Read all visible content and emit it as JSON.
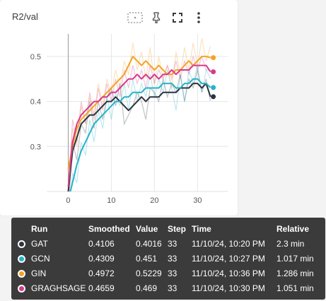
{
  "card": {
    "title": "R2/val",
    "tools": [
      {
        "name": "data-selection-icon"
      },
      {
        "name": "pin-icon"
      },
      {
        "name": "fullscreen-icon"
      },
      {
        "name": "more-vert-icon"
      }
    ]
  },
  "chart_data": {
    "type": "line",
    "title": "R2/val",
    "xlabel": "",
    "ylabel": "",
    "xlim": [
      -5,
      37
    ],
    "ylim": [
      0.2,
      0.55
    ],
    "xticks": [
      0,
      10,
      20,
      30
    ],
    "yticks": [
      0.3,
      0.4,
      0.5
    ],
    "grid": true,
    "series": [
      {
        "name": "GAT",
        "color": "#2b3440",
        "x": [
          0,
          1,
          2,
          3,
          4,
          5,
          6,
          7,
          8,
          9,
          10,
          11,
          12,
          13,
          14,
          15,
          16,
          17,
          18,
          19,
          20,
          21,
          22,
          23,
          24,
          25,
          26,
          27,
          28,
          29,
          30,
          31,
          32,
          33
        ],
        "smoothed": [
          0.2,
          0.29,
          0.32,
          0.35,
          0.36,
          0.37,
          0.37,
          0.38,
          0.39,
          0.4,
          0.4,
          0.41,
          0.4,
          0.39,
          0.38,
          0.39,
          0.4,
          0.41,
          0.4,
          0.41,
          0.41,
          0.41,
          0.42,
          0.42,
          0.42,
          0.42,
          0.43,
          0.43,
          0.43,
          0.44,
          0.44,
          0.43,
          0.44,
          0.4106
        ],
        "raw": [
          0.15,
          0.31,
          0.27,
          0.35,
          0.33,
          0.4,
          0.34,
          0.4,
          0.36,
          0.41,
          0.43,
          0.39,
          0.44,
          0.35,
          0.37,
          0.39,
          0.42,
          0.4,
          0.36,
          0.43,
          0.42,
          0.4,
          0.45,
          0.41,
          0.44,
          0.42,
          0.46,
          0.4,
          0.45,
          0.43,
          0.47,
          0.42,
          0.45,
          0.4016
        ]
      },
      {
        "name": "GCN",
        "color": "#26b3c7",
        "x": [
          0,
          1,
          2,
          3,
          4,
          5,
          6,
          7,
          8,
          9,
          10,
          11,
          12,
          13,
          14,
          15,
          16,
          17,
          18,
          19,
          20,
          21,
          22,
          23,
          24,
          25,
          26,
          27,
          28,
          29,
          30,
          31,
          32,
          33
        ],
        "smoothed": [
          0.18,
          0.22,
          0.26,
          0.29,
          0.31,
          0.33,
          0.35,
          0.36,
          0.37,
          0.38,
          0.39,
          0.4,
          0.4,
          0.41,
          0.41,
          0.42,
          0.42,
          0.42,
          0.43,
          0.43,
          0.43,
          0.43,
          0.44,
          0.44,
          0.44,
          0.43,
          0.43,
          0.44,
          0.44,
          0.45,
          0.45,
          0.44,
          0.44,
          0.4309
        ],
        "raw": [
          0.15,
          0.24,
          0.22,
          0.31,
          0.28,
          0.36,
          0.31,
          0.38,
          0.34,
          0.41,
          0.36,
          0.42,
          0.39,
          0.44,
          0.38,
          0.45,
          0.4,
          0.44,
          0.41,
          0.46,
          0.41,
          0.45,
          0.42,
          0.47,
          0.43,
          0.38,
          0.46,
          0.4,
          0.47,
          0.44,
          0.48,
          0.42,
          0.47,
          0.451
        ]
      },
      {
        "name": "GIN",
        "color": "#f4a325",
        "x": [
          0,
          1,
          2,
          3,
          4,
          5,
          6,
          7,
          8,
          9,
          10,
          11,
          12,
          13,
          14,
          15,
          16,
          17,
          18,
          19,
          20,
          21,
          22,
          23,
          24,
          25,
          26,
          27,
          28,
          29,
          30,
          31,
          32,
          33
        ],
        "smoothed": [
          0.25,
          0.3,
          0.34,
          0.36,
          0.37,
          0.38,
          0.39,
          0.4,
          0.41,
          0.42,
          0.43,
          0.44,
          0.45,
          0.46,
          0.48,
          0.5,
          0.49,
          0.48,
          0.49,
          0.48,
          0.47,
          0.48,
          0.47,
          0.46,
          0.46,
          0.47,
          0.47,
          0.48,
          0.49,
          0.48,
          0.49,
          0.5,
          0.5,
          0.4972
        ],
        "raw": [
          0.22,
          0.34,
          0.3,
          0.39,
          0.35,
          0.41,
          0.37,
          0.44,
          0.39,
          0.45,
          0.42,
          0.47,
          0.43,
          0.49,
          0.46,
          0.53,
          0.47,
          0.51,
          0.45,
          0.52,
          0.44,
          0.5,
          0.45,
          0.48,
          0.43,
          0.51,
          0.46,
          0.52,
          0.47,
          0.53,
          0.48,
          0.54,
          0.49,
          0.5229
        ]
      },
      {
        "name": "GRAGHSAGE",
        "color": "#d63a8a",
        "x": [
          0,
          1,
          2,
          3,
          4,
          5,
          6,
          7,
          8,
          9,
          10,
          11,
          12,
          13,
          14,
          15,
          16,
          17,
          18,
          19,
          20,
          21,
          22,
          23,
          24,
          25,
          26,
          27,
          28,
          29,
          30,
          31,
          32,
          33
        ],
        "smoothed": [
          0.21,
          0.31,
          0.35,
          0.37,
          0.38,
          0.39,
          0.4,
          0.4,
          0.41,
          0.41,
          0.42,
          0.42,
          0.43,
          0.44,
          0.45,
          0.45,
          0.46,
          0.45,
          0.46,
          0.45,
          0.46,
          0.45,
          0.46,
          0.46,
          0.47,
          0.46,
          0.47,
          0.47,
          0.47,
          0.48,
          0.48,
          0.48,
          0.48,
          0.4659
        ],
        "raw": [
          0.18,
          0.36,
          0.31,
          0.4,
          0.35,
          0.42,
          0.36,
          0.43,
          0.38,
          0.44,
          0.4,
          0.45,
          0.41,
          0.47,
          0.43,
          0.48,
          0.44,
          0.47,
          0.43,
          0.48,
          0.44,
          0.47,
          0.45,
          0.48,
          0.45,
          0.49,
          0.45,
          0.49,
          0.46,
          0.5,
          0.47,
          0.5,
          0.47,
          0.469
        ]
      }
    ]
  },
  "tooltip": {
    "headers": {
      "run": "Run",
      "smoothed": "Smoothed",
      "value": "Value",
      "step": "Step",
      "time": "Time",
      "relative": "Relative"
    },
    "rows": [
      {
        "run": "GAT",
        "color": "#2b3440",
        "smoothed": "0.4106",
        "value": "0.4016",
        "step": "33",
        "time": "11/10/24, 10:20 PM",
        "relative": "2.3 min"
      },
      {
        "run": "GCN",
        "color": "#26b3c7",
        "smoothed": "0.4309",
        "value": "0.451",
        "step": "33",
        "time": "11/10/24, 10:27 PM",
        "relative": "1.017 min"
      },
      {
        "run": "GIN",
        "color": "#f4a325",
        "smoothed": "0.4972",
        "value": "0.5229",
        "step": "33",
        "time": "11/10/24, 10:36 PM",
        "relative": "1.286 min"
      },
      {
        "run": "GRAGHSAGE",
        "color": "#d63a8a",
        "smoothed": "0.4659",
        "value": "0.469",
        "step": "33",
        "time": "11/10/24, 10:30 PM",
        "relative": "1.051 min"
      }
    ]
  }
}
